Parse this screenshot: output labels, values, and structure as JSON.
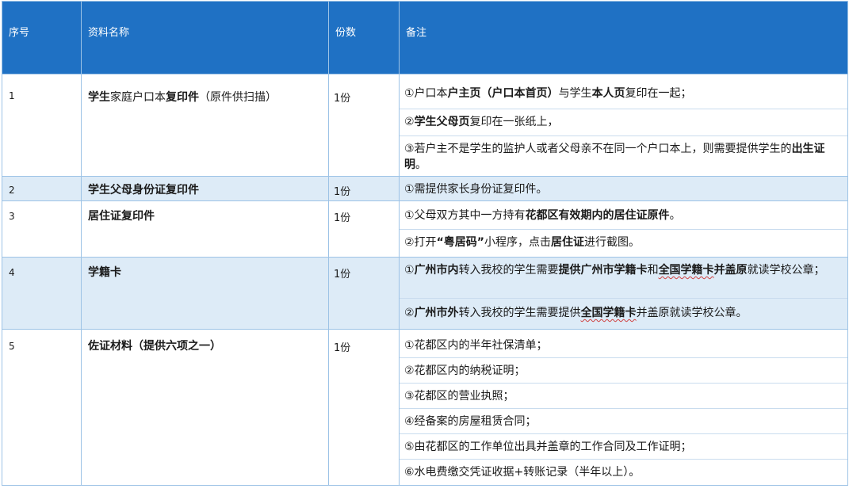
{
  "headers": [
    "序号",
    "资料名称",
    "份数",
    "备注"
  ],
  "rows": [
    {
      "index": "1",
      "name": [
        {
          "t": "学生",
          "b": true
        },
        {
          "t": "家庭户口本",
          "b": false
        },
        {
          "t": "复印件",
          "b": true
        },
        {
          "t": "（原件供扫描）",
          "b": false
        }
      ],
      "copies": "1份",
      "notes": [
        [
          {
            "t": "①户口本",
            "b": false
          },
          {
            "t": "户主页（户口本首页）",
            "b": true
          },
          {
            "t": "与学生",
            "b": false
          },
          {
            "t": "本人页",
            "b": true
          },
          {
            "t": "复印在一起；",
            "b": false
          }
        ],
        [
          {
            "t": "②",
            "b": false
          },
          {
            "t": "学生父母页",
            "b": true
          },
          {
            "t": "复印在一张纸上，",
            "b": false
          }
        ],
        [
          {
            "t": "③若户主不是学生的监护人或者父母亲不在同一个户口本上，则需要提供学生的",
            "b": false
          },
          {
            "t": "出生证明",
            "b": true
          },
          {
            "t": "。",
            "b": false
          }
        ]
      ]
    },
    {
      "index": "2",
      "name": [
        {
          "t": "学生父母身份证复印件",
          "b": true
        }
      ],
      "copies": "1份",
      "notes": [
        [
          {
            "t": "①需提供家长身份证复印件。",
            "b": false
          }
        ]
      ]
    },
    {
      "index": "3",
      "name": [
        {
          "t": "居住证复印件",
          "b": true
        }
      ],
      "copies": "1份",
      "notes": [
        [
          {
            "t": "①父母双方其中一方持有",
            "b": false
          },
          {
            "t": "花都区有效期内的居住证原件",
            "b": true
          },
          {
            "t": "。",
            "b": false
          }
        ],
        [
          {
            "t": "②打开",
            "b": false
          },
          {
            "t": "“粤居码”",
            "b": true
          },
          {
            "t": "小程序，点击",
            "b": false
          },
          {
            "t": "居住证",
            "b": true
          },
          {
            "t": "进行截图。",
            "b": false
          }
        ]
      ]
    },
    {
      "index": "4",
      "name": [
        {
          "t": "学籍卡",
          "b": true
        }
      ],
      "copies": "1份",
      "notes": [
        [
          {
            "t": "①",
            "b": false
          },
          {
            "t": "广州市内",
            "b": true
          },
          {
            "t": "转入我校的学生需要",
            "b": false
          },
          {
            "t": "提供广州市学籍卡",
            "b": true
          },
          {
            "t": "和",
            "b": false
          },
          {
            "t": "全国学籍卡",
            "b": true,
            "w": true
          },
          {
            "t": "并盖原",
            "b": true
          },
          {
            "t": "就读学校公章；",
            "b": false
          }
        ],
        [
          {
            "t": "②",
            "b": false
          },
          {
            "t": "广州市外",
            "b": true
          },
          {
            "t": "转入我校的学生需要提供",
            "b": false
          },
          {
            "t": "全国学籍卡",
            "b": true,
            "w": true
          },
          {
            "t": "并盖原就读学校公章。",
            "b": false
          }
        ]
      ]
    },
    {
      "index": "5",
      "name": [
        {
          "t": "佐证材料（提供六项之一）",
          "b": true
        }
      ],
      "copies": "1份",
      "notes": [
        [
          {
            "t": "①花都区内的半年社保清单；",
            "b": false
          }
        ],
        [
          {
            "t": "②花都区内的纳税证明；",
            "b": false
          }
        ],
        [
          {
            "t": "③花都区的营业执照；",
            "b": false
          }
        ],
        [
          {
            "t": "④经备案的房屋租赁合同；",
            "b": false
          }
        ],
        [
          {
            "t": "⑤由花都区的工作单位出具并盖章的工作合同及工作证明；",
            "b": false
          }
        ],
        [
          {
            "t": "⑥水电费缴交凭证收据+转账记录（半年以上）。",
            "b": false
          }
        ]
      ]
    }
  ]
}
